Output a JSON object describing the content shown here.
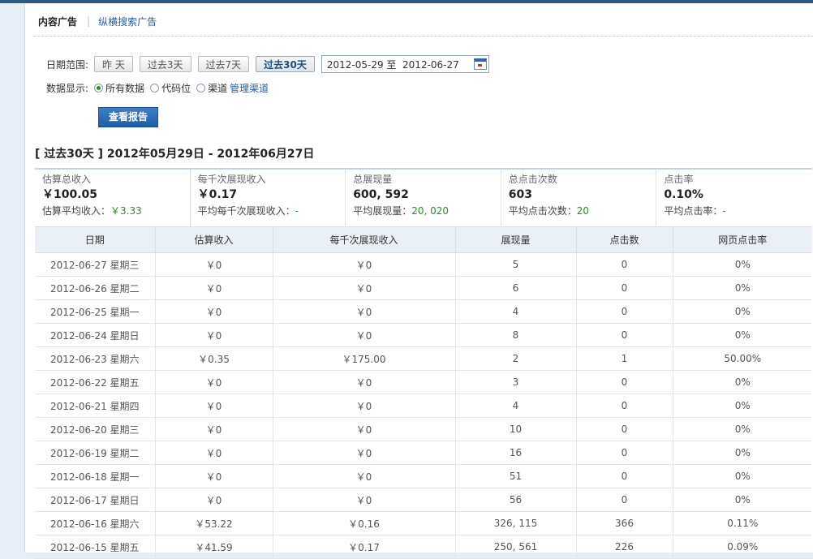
{
  "tabs": {
    "active": "内容广告",
    "other": "纵横搜索广告"
  },
  "filters": {
    "date_label": "日期范围:",
    "quick_ranges": [
      "昨 天",
      "过去3天",
      "过去7天",
      "过去30天"
    ],
    "active_range": "过去30天",
    "date_value": "2012-05-29 至  2012-06-27",
    "data_label": "数据显示:",
    "options": [
      "所有数据",
      "代码位",
      "渠道"
    ],
    "selected_option": "所有数据",
    "manage_link": "管理渠道",
    "submit_label": "查看报告"
  },
  "report_title": "[ 过去30天 ] 2012年05月29日 - 2012年06月27日",
  "summary": [
    {
      "title": "估算总收入",
      "value": "￥100.05",
      "avg_label": "估算平均收入：",
      "avg_value": "￥3.33"
    },
    {
      "title": "每千次展现收入",
      "value": "￥0.17",
      "avg_label": "平均每千次展现收入：",
      "avg_value": "-"
    },
    {
      "title": "总展现量",
      "value": "600, 592",
      "avg_label": "平均展现量：",
      "avg_value": "20, 020"
    },
    {
      "title": "总点击次数",
      "value": "603",
      "avg_label": "平均点击次数：",
      "avg_value": "20"
    },
    {
      "title": "点击率",
      "value": "0.10%",
      "avg_label": "平均点击率：",
      "avg_value": "-"
    }
  ],
  "table": {
    "headers": [
      "日期",
      "估算收入",
      "每千次展现收入",
      "展现量",
      "点击数",
      "网页点击率"
    ],
    "rows": [
      [
        "2012-06-27 星期三",
        "￥0",
        "￥0",
        "5",
        "0",
        "0%"
      ],
      [
        "2012-06-26 星期二",
        "￥0",
        "￥0",
        "6",
        "0",
        "0%"
      ],
      [
        "2012-06-25 星期一",
        "￥0",
        "￥0",
        "4",
        "0",
        "0%"
      ],
      [
        "2012-06-24 星期日",
        "￥0",
        "￥0",
        "8",
        "0",
        "0%"
      ],
      [
        "2012-06-23 星期六",
        "￥0.35",
        "￥175.00",
        "2",
        "1",
        "50.00%"
      ],
      [
        "2012-06-22 星期五",
        "￥0",
        "￥0",
        "3",
        "0",
        "0%"
      ],
      [
        "2012-06-21 星期四",
        "￥0",
        "￥0",
        "4",
        "0",
        "0%"
      ],
      [
        "2012-06-20 星期三",
        "￥0",
        "￥0",
        "10",
        "0",
        "0%"
      ],
      [
        "2012-06-19 星期二",
        "￥0",
        "￥0",
        "16",
        "0",
        "0%"
      ],
      [
        "2012-06-18 星期一",
        "￥0",
        "￥0",
        "51",
        "0",
        "0%"
      ],
      [
        "2012-06-17 星期日",
        "￥0",
        "￥0",
        "56",
        "0",
        "0%"
      ],
      [
        "2012-06-16 星期六",
        "￥53.22",
        "￥0.16",
        "326, 115",
        "366",
        "0.11%"
      ],
      [
        "2012-06-15 星期五",
        "￥41.59",
        "￥0.17",
        "250, 561",
        "226",
        "0.09%"
      ]
    ]
  }
}
